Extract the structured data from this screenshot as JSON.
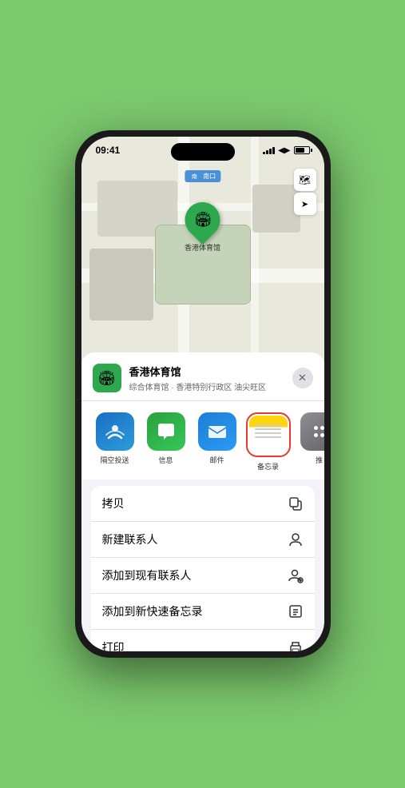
{
  "status_bar": {
    "time": "09:41",
    "signal_label": "signal",
    "wifi_label": "wifi",
    "battery_label": "battery"
  },
  "map": {
    "north_label": "南口",
    "north_label_prefix": "南",
    "pin_label": "香港体育馆",
    "controls": {
      "map_btn": "🗺",
      "location_btn": "➤"
    }
  },
  "venue": {
    "icon": "🏟",
    "name": "香港体育馆",
    "subtitle": "综合体育馆 · 香港特别行政区 油尖旺区",
    "close_label": "✕"
  },
  "share_apps": [
    {
      "id": "airdrop",
      "label": "隔空投送",
      "icon_type": "airdrop"
    },
    {
      "id": "messages",
      "label": "信息",
      "icon_type": "messages"
    },
    {
      "id": "mail",
      "label": "邮件",
      "icon_type": "mail"
    },
    {
      "id": "notes",
      "label": "备忘录",
      "icon_type": "notes",
      "highlighted": true
    },
    {
      "id": "more",
      "label": "推",
      "icon_type": "more"
    }
  ],
  "actions": [
    {
      "id": "copy",
      "label": "拷贝",
      "icon": "⿻"
    },
    {
      "id": "new-contact",
      "label": "新建联系人",
      "icon": "👤"
    },
    {
      "id": "add-existing",
      "label": "添加到现有联系人",
      "icon": "👤"
    },
    {
      "id": "add-note",
      "label": "添加到新快速备忘录",
      "icon": "⊡"
    },
    {
      "id": "print",
      "label": "打印",
      "icon": "🖨"
    }
  ]
}
